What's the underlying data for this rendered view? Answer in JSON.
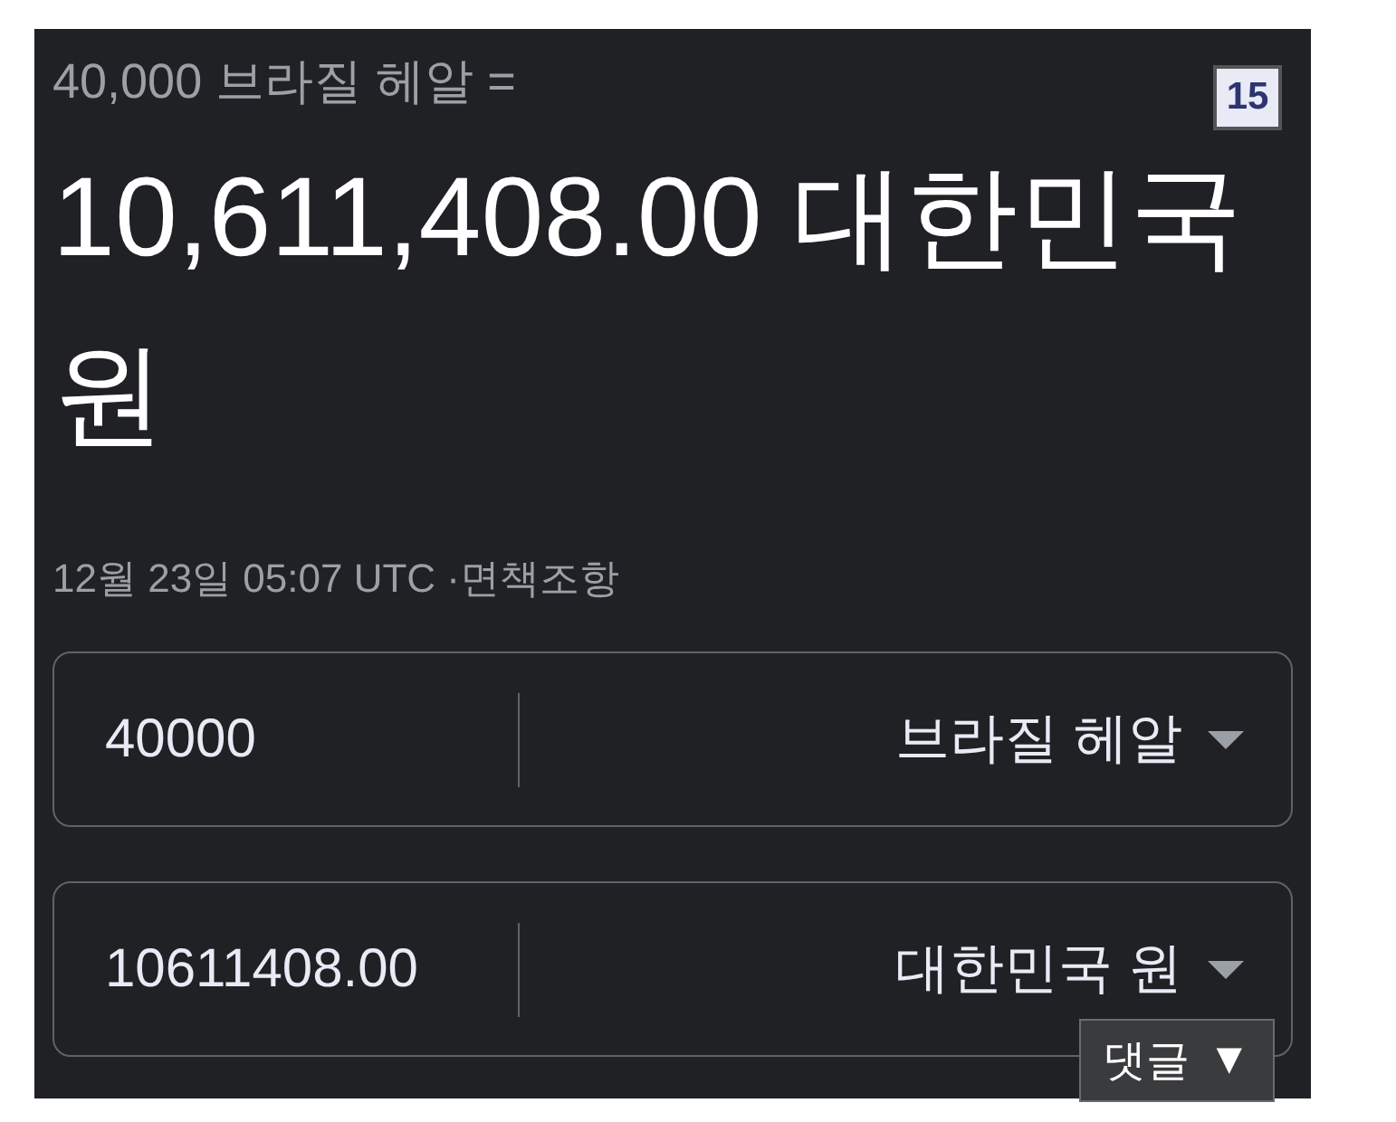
{
  "header": {
    "query": "40,000 브라질 헤알 =",
    "result": "10,611,408.00 대한민국 원",
    "timestamp": "12월 23일 05:07 UTC · ",
    "disclaimer_link": "면책조항"
  },
  "converter": [
    {
      "amount": "40000",
      "currency": "브라질 헤알"
    },
    {
      "amount": "10611408.00",
      "currency": "대한민국 원"
    }
  ],
  "page_badge": "15",
  "comment_button": {
    "label": "댓글",
    "arrow": "▼"
  }
}
